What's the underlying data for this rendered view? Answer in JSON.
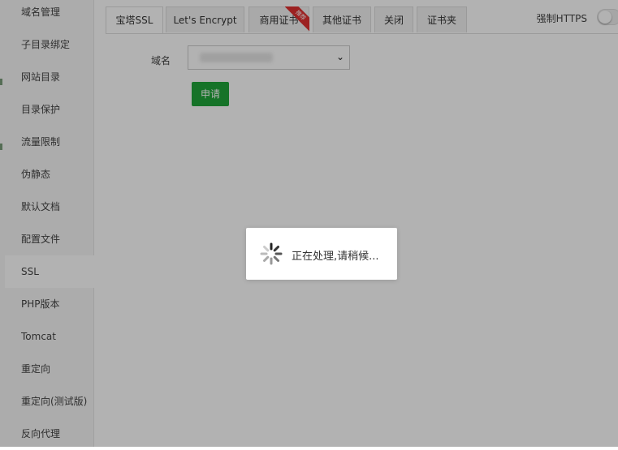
{
  "sidebar": {
    "items": [
      {
        "label": "域名管理"
      },
      {
        "label": "子目录绑定"
      },
      {
        "label": "网站目录"
      },
      {
        "label": "目录保护"
      },
      {
        "label": "流量限制"
      },
      {
        "label": "伪静态"
      },
      {
        "label": "默认文档"
      },
      {
        "label": "配置文件"
      },
      {
        "label": "SSL"
      },
      {
        "label": "PHP版本"
      },
      {
        "label": "Tomcat"
      },
      {
        "label": "重定向"
      },
      {
        "label": "重定向(测试版)"
      },
      {
        "label": "反向代理"
      }
    ],
    "active": "SSL"
  },
  "tabs": [
    {
      "label": "宝塔SSL"
    },
    {
      "label": "Let's Encrypt"
    },
    {
      "label": "商用证书"
    },
    {
      "label": "其他证书"
    },
    {
      "label": "关闭"
    },
    {
      "label": "证书夹"
    }
  ],
  "active_tab": "宝塔SSL",
  "tab_badge": "推荐",
  "force_https": {
    "label": "强制HTTPS",
    "enabled": false
  },
  "form": {
    "domain_label": "域名",
    "apply_label": "申请"
  },
  "loading": {
    "text": "正在处理,请稍候..."
  },
  "colors": {
    "accent_green": "#20a53a",
    "badge_red": "#e03030"
  }
}
